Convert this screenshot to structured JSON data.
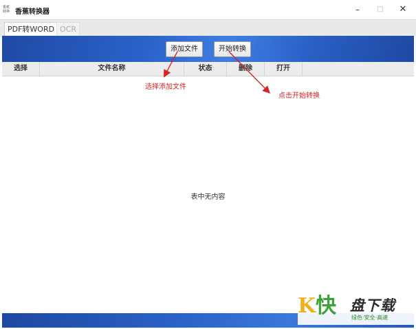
{
  "window": {
    "app_icon_text": "香蕉 转换",
    "title": "香蕉转换器",
    "minimize_glyph": "–",
    "maximize_glyph": "□",
    "close_glyph": "✕"
  },
  "tabs": [
    {
      "label": "PDF转WORD",
      "active": true
    },
    {
      "label": "OCR",
      "active": false
    }
  ],
  "toolbar": {
    "add_label": "添加文件",
    "start_label": "开始转换"
  },
  "table": {
    "columns": [
      "选择",
      "文件名称",
      "状态",
      "删除",
      "打开"
    ],
    "empty_text": "表中无内容"
  },
  "annotations": {
    "add_hint": "选择添加文件",
    "start_hint": "点击开始转换"
  },
  "watermark": {
    "logo_char1": "K",
    "logo_char2": "快",
    "brand": "盘下载",
    "tagline": "绿色·安全·高速"
  },
  "colors": {
    "toolbar_blue": "#2a62c9",
    "annotation_red": "#d62525"
  }
}
